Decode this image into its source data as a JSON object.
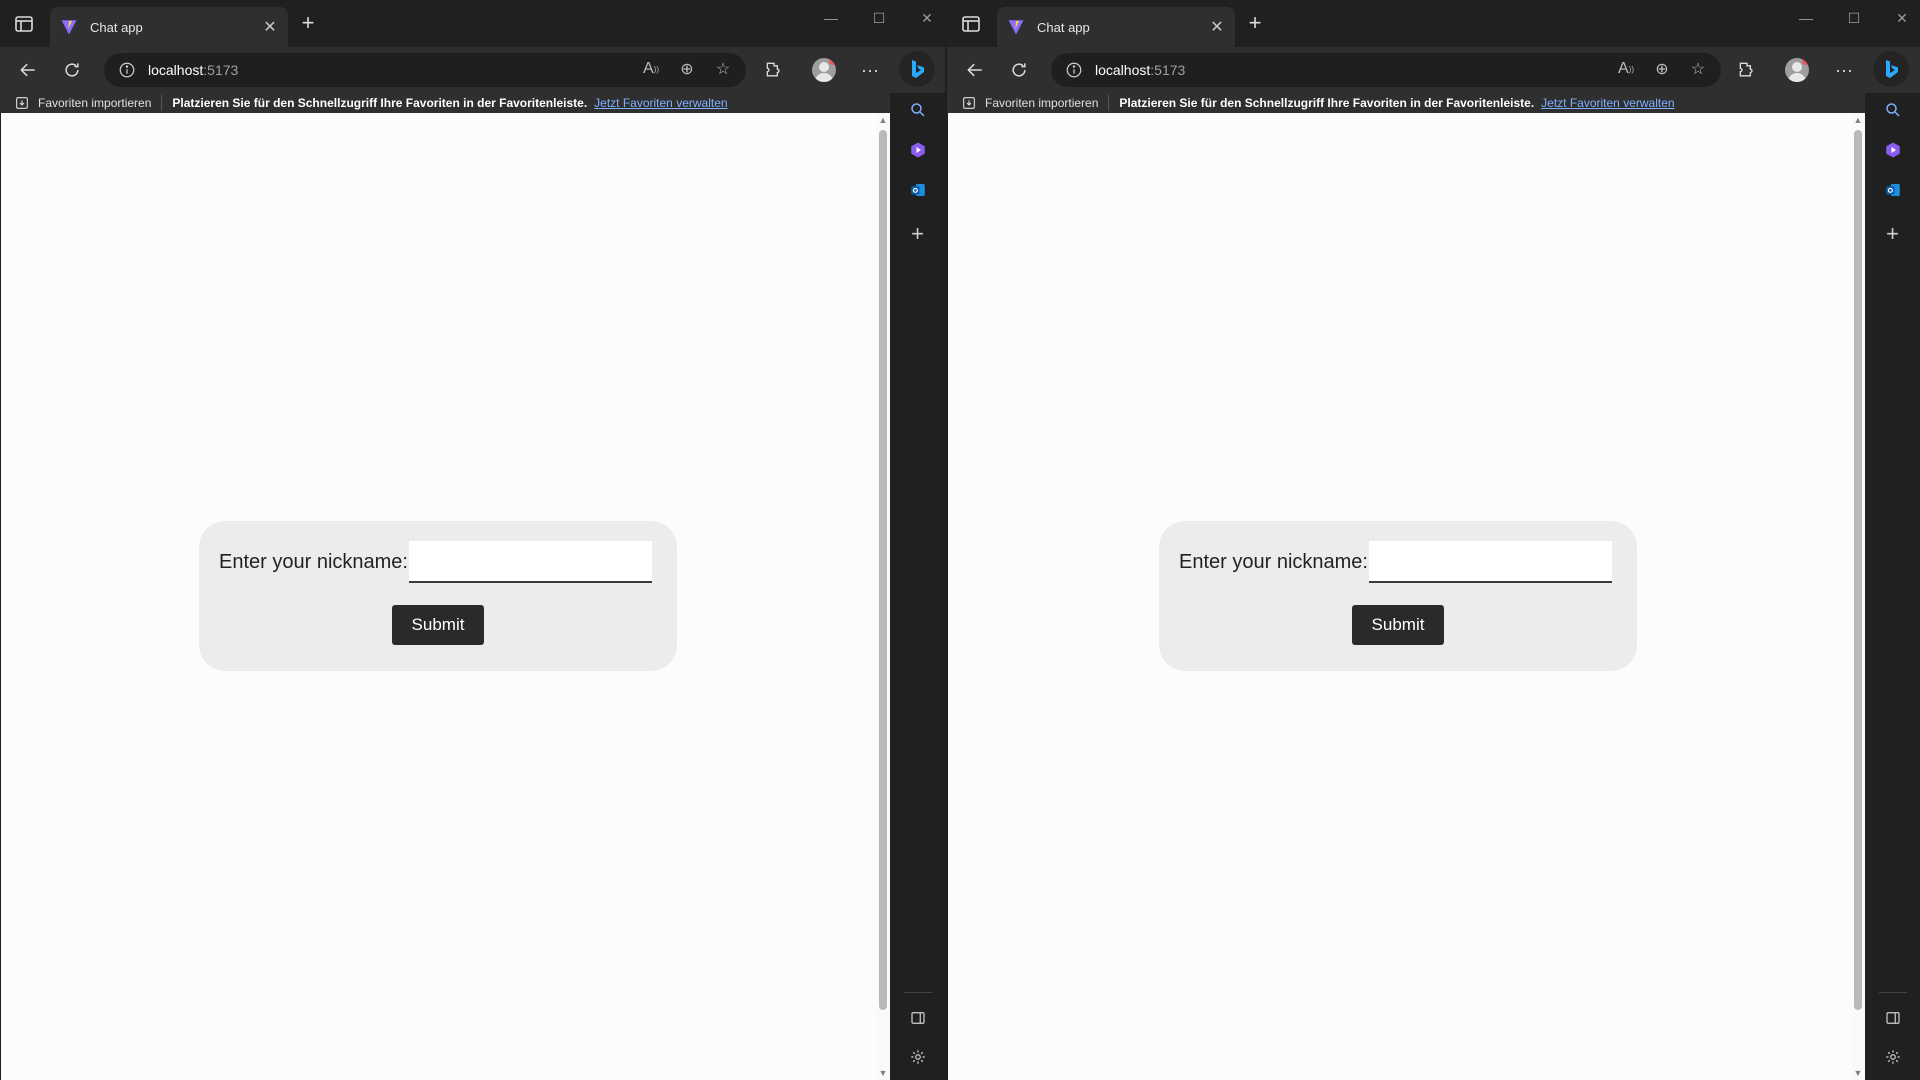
{
  "windows": [
    {
      "tab": {
        "title": "Chat app"
      },
      "address": {
        "host": "localhost",
        "port": ":5173"
      },
      "favorites_bar": {
        "import_label": "Favoriten importieren",
        "hint": "Platzieren Sie für den Schnellzugriff Ihre Favoriten in der Favoritenleiste.",
        "link": "Jetzt Favoriten verwalten"
      },
      "page": {
        "nickname_label": "Enter your nickname:",
        "nickname_value": "",
        "submit_label": "Submit"
      }
    },
    {
      "tab": {
        "title": "Chat app"
      },
      "address": {
        "host": "localhost",
        "port": ":5173"
      },
      "favorites_bar": {
        "import_label": "Favoriten importieren",
        "hint": "Platzieren Sie für den Schnellzugriff Ihre Favoriten in der Favoritenleiste.",
        "link": "Jetzt Favoriten verwalten"
      },
      "page": {
        "nickname_label": "Enter your nickname:",
        "nickname_value": "",
        "submit_label": "Submit"
      }
    }
  ],
  "icons": {
    "tab_actions": "tab-actions-icon",
    "favicon": "vite-logo-icon",
    "close_tab": "close-icon",
    "new_tab": "plus-icon",
    "back": "back-arrow-icon",
    "refresh": "refresh-icon",
    "site_info": "info-icon",
    "read_aloud": "read-aloud-icon",
    "zoom": "zoom-icon",
    "add_favorite": "favorite-add-icon",
    "extensions": "extensions-icon",
    "profile": "avatar",
    "more": "more-icon",
    "copilot": "bing-icon",
    "sidebar_search": "search-icon",
    "sidebar_games": "games-icon",
    "sidebar_outlook": "outlook-icon",
    "sidebar_add": "plus-icon",
    "sidebar_panel": "sidebar-panel-icon",
    "sidebar_settings": "gear-icon"
  },
  "colors": {
    "chrome": "#202020",
    "toolbar": "#2f2f2f",
    "page": "#fcfcfc",
    "card": "#ececec",
    "button": "#2a2a2a",
    "link": "#7fb0ff"
  }
}
